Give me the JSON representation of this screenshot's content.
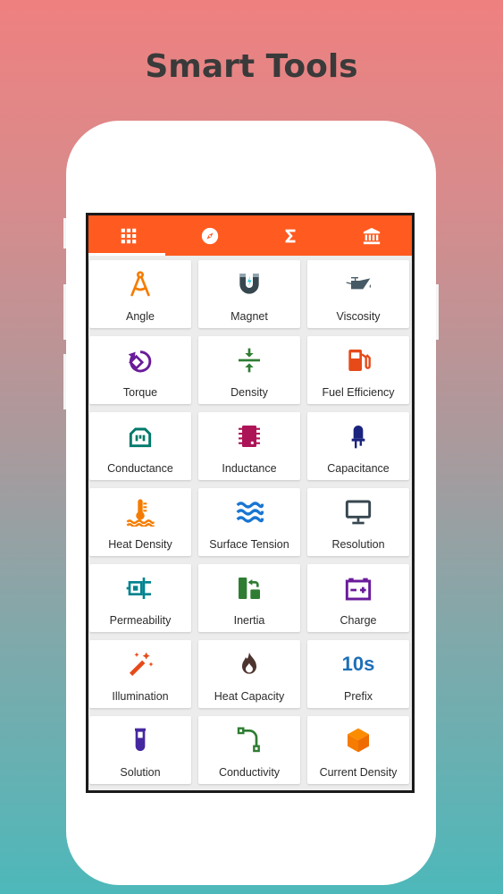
{
  "headline": "Smart Tools",
  "colors": {
    "accent": "#ff5a1f",
    "tab_icon": "#ffffff"
  },
  "tabs": [
    {
      "icon": "grid-icon",
      "active": true
    },
    {
      "icon": "compass-icon",
      "active": false
    },
    {
      "icon": "sigma-icon",
      "active": false
    },
    {
      "icon": "bank-icon",
      "active": false
    }
  ],
  "tools": [
    {
      "label": "Angle",
      "icon": "angle-compass-icon",
      "color": "#f57c00"
    },
    {
      "label": "Magnet",
      "icon": "magnet-icon",
      "color": "#37474f"
    },
    {
      "label": "Viscosity",
      "icon": "oil-can-icon",
      "color": "#455a64"
    },
    {
      "label": "Torque",
      "icon": "rotate-icon",
      "color": "#6a1b9a"
    },
    {
      "label": "Density",
      "icon": "compress-icon",
      "color": "#2e7d32"
    },
    {
      "label": "Fuel Efficiency",
      "icon": "fuel-pump-icon",
      "color": "#e64a19"
    },
    {
      "label": "Conductance",
      "icon": "power-socket-icon",
      "color": "#00796b"
    },
    {
      "label": "Inductance",
      "icon": "chip-icon",
      "color": "#ad1457"
    },
    {
      "label": "Capacitance",
      "icon": "led-icon",
      "color": "#1a237e"
    },
    {
      "label": "Heat Density",
      "icon": "thermometer-icon",
      "color": "#f57c00"
    },
    {
      "label": "Surface Tension",
      "icon": "waves-icon",
      "color": "#1976d2"
    },
    {
      "label": "Resolution",
      "icon": "monitor-icon",
      "color": "#37474f"
    },
    {
      "label": "Permeability",
      "icon": "settings-input-icon",
      "color": "#00838f"
    },
    {
      "label": "Inertia",
      "icon": "inertia-icon",
      "color": "#2e7d32"
    },
    {
      "label": "Charge",
      "icon": "battery-icon",
      "color": "#6a1b9a"
    },
    {
      "label": "Illumination",
      "icon": "magic-wand-icon",
      "color": "#e64a19"
    },
    {
      "label": "Heat Capacity",
      "icon": "flame-icon",
      "color": "#4e342e"
    },
    {
      "label": "Prefix",
      "icon": "prefix-10s-icon",
      "icon_text": "10s",
      "color": "#1e6fb8"
    },
    {
      "label": "Solution",
      "icon": "test-tube-icon",
      "color": "#4527a0"
    },
    {
      "label": "Conductivity",
      "icon": "bezier-curve-icon",
      "color": "#2e7d32"
    },
    {
      "label": "Current Density",
      "icon": "cube-icon",
      "color": "#f57c00"
    }
  ]
}
